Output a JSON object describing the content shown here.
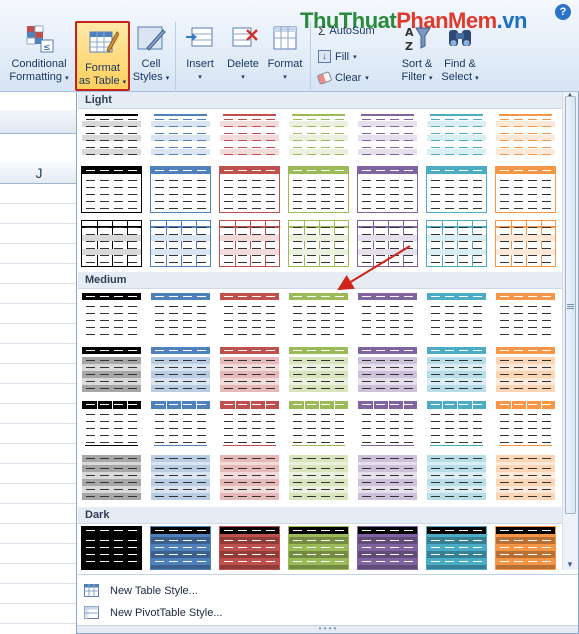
{
  "ribbon": {
    "conditional_formatting": [
      "Conditional",
      "Formatting"
    ],
    "format_as_table": [
      "Format",
      "as Table"
    ],
    "cell_styles": [
      "Cell",
      "Styles"
    ],
    "insert": "Insert",
    "delete": "Delete",
    "format": "Format",
    "autosum_label": "AutoSum",
    "fill_label": "Fill",
    "clear_label": "Clear",
    "sort_filter": [
      "Sort &",
      "Filter"
    ],
    "find_select": [
      "Find &",
      "Select"
    ],
    "help": "?"
  },
  "watermark": {
    "part1": "Thu",
    "part2": "Thuat",
    "part3": "PhanMem",
    "part4": ".vn"
  },
  "sheet": {
    "column_label": "J"
  },
  "gallery": {
    "sections": [
      "Light",
      "Medium",
      "Dark"
    ],
    "style_colors": [
      "#000000",
      "#4f81bd",
      "#c0504d",
      "#9bbb59",
      "#8064a2",
      "#4bacc6",
      "#f79646"
    ],
    "light_colors": [
      "#d9d9d9",
      "#dbe5f1",
      "#f2dcdb",
      "#ebf1de",
      "#e5e0ec",
      "#dbeef3",
      "#fde9d9"
    ],
    "mid_colors": [
      "#a6a6a6",
      "#b8cce4",
      "#e6b8b7",
      "#d7e4bc",
      "#ccc0da",
      "#b7dee8",
      "#fcd5b4"
    ]
  },
  "menu": {
    "new_table_style": "New Table Style...",
    "new_pivot_style": "New PivotTable Style..."
  }
}
